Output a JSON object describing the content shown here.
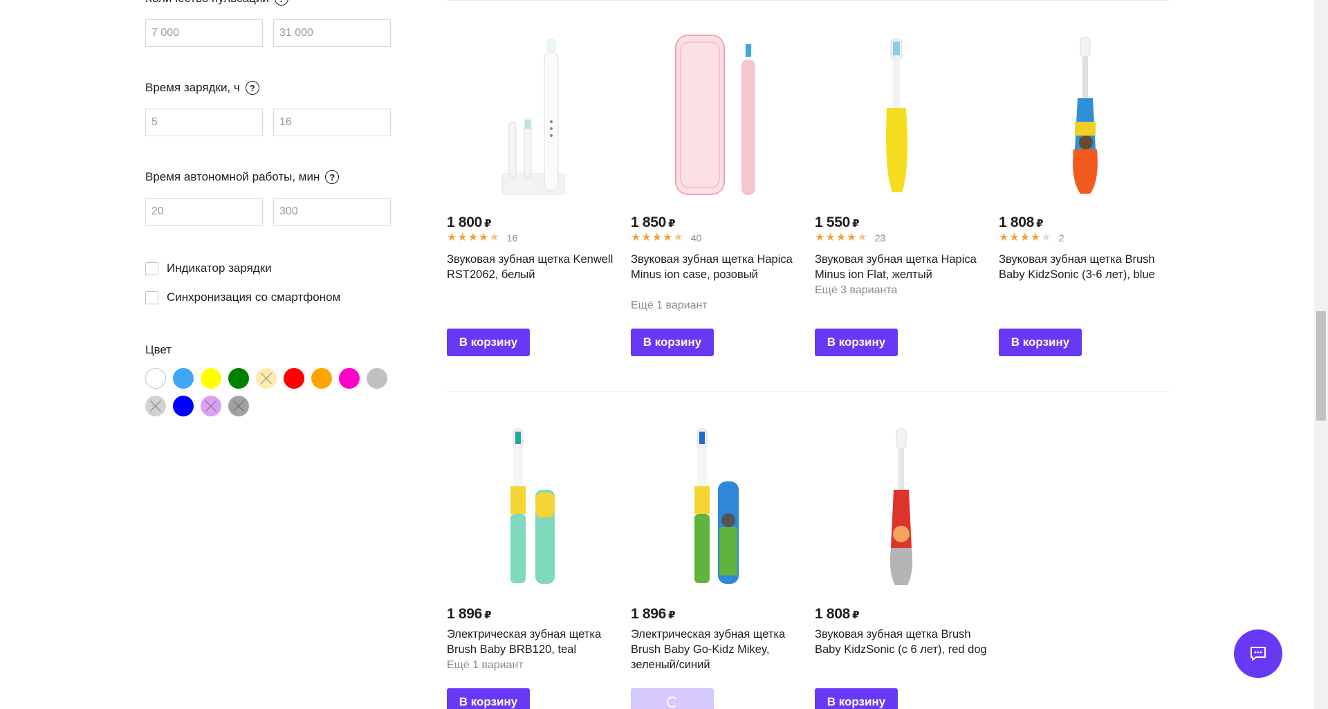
{
  "filters": {
    "pulsations": {
      "label": "Количество пульсаций",
      "min": "7 000",
      "max": "31 000"
    },
    "charge_time": {
      "label": "Время зарядки, ч",
      "min": "5",
      "max": "16"
    },
    "autonomy": {
      "label": "Время автономной работы, мин",
      "min": "20",
      "max": "300"
    },
    "help_glyph": "?",
    "checkboxes": [
      {
        "label": "Индикатор зарядки",
        "checked": false
      },
      {
        "label": "Синхронизация со смартфоном",
        "checked": false
      }
    ],
    "color": {
      "label": "Цвет",
      "swatches": [
        {
          "name": "white",
          "hex": "#ffffff",
          "disabled": false
        },
        {
          "name": "light-blue",
          "hex": "#3ea8f5",
          "disabled": false
        },
        {
          "name": "yellow",
          "hex": "#ffff00",
          "disabled": false
        },
        {
          "name": "green",
          "hex": "#008000",
          "disabled": false
        },
        {
          "name": "light-yellow",
          "hex": "#fde79d",
          "disabled": true
        },
        {
          "name": "red",
          "hex": "#ff0000",
          "disabled": false
        },
        {
          "name": "orange",
          "hex": "#ffa500",
          "disabled": false
        },
        {
          "name": "pink",
          "hex": "#ff00c8",
          "disabled": false
        },
        {
          "name": "gray",
          "hex": "#c0c0c0",
          "disabled": false
        },
        {
          "name": "silver",
          "hex": "#c8c8c8",
          "disabled": true
        },
        {
          "name": "blue",
          "hex": "#0000ff",
          "disabled": false
        },
        {
          "name": "violet",
          "hex": "#d08cf2",
          "disabled": true
        },
        {
          "name": "dark-gray",
          "hex": "#8c8c8c",
          "disabled": true
        }
      ]
    }
  },
  "currency": "₽",
  "cart_label": "В корзину",
  "products": [
    {
      "price": "1 800",
      "rating": 4.5,
      "reviews": "16",
      "title": "Звуковая зубная щетка Kenwell RST2062, белый",
      "variants": "",
      "image": "white-toothbrush-with-stand"
    },
    {
      "price": "1 850",
      "rating": 4.5,
      "reviews": "40",
      "title": "Звуковая зубная щетка Hapica Minus ion case, розовый",
      "variants": "Ещё 1 вариант",
      "image": "pink-toothbrush-with-case"
    },
    {
      "price": "1 550",
      "rating": 4.5,
      "reviews": "23",
      "title": "Звуковая зубная щетка Hapica Minus ion Flat, желтый",
      "variants": "Ещё 3 варианта",
      "image": "yellow-toothbrush"
    },
    {
      "price": "1 808",
      "rating": 4,
      "reviews": "2",
      "title": "Звуковая зубная щетка Brush Baby KidzSonic (3-6 лет), blue",
      "variants": "",
      "image": "kids-toothbrush-blue"
    },
    {
      "price": "1 896",
      "rating": null,
      "reviews": "",
      "title": "Электрическая зубная щетка Brush Baby BRB120, teal",
      "variants": "Ещё 1 вариант",
      "image": "teal-toothbrush-with-cap"
    },
    {
      "price": "1 896",
      "rating": null,
      "reviews": "",
      "title": "Электрическая зубная щетка Brush Baby Go-Kidz Mikey, зеленый/синий",
      "variants": "",
      "image": "green-blue-kids-toothbrush",
      "loading": true
    },
    {
      "price": "1 808",
      "rating": null,
      "reviews": "",
      "title": "Звуковая зубная щетка Brush Baby KidzSonic (с 6 лет), red dog",
      "variants": "",
      "image": "red-kids-toothbrush"
    }
  ]
}
